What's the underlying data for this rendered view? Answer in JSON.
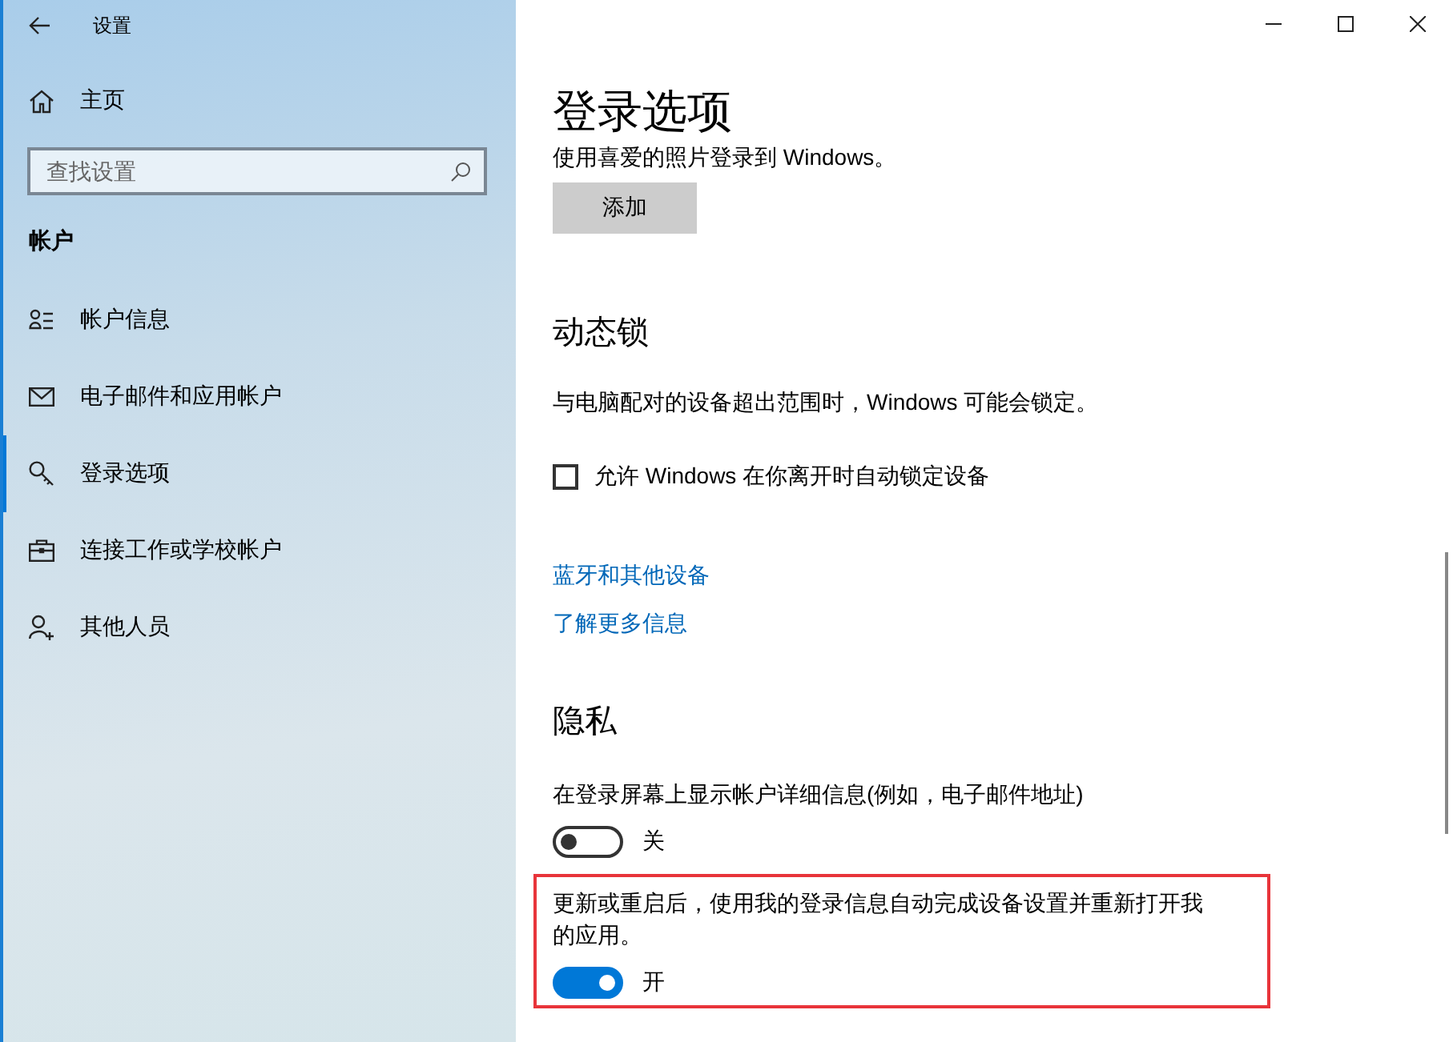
{
  "window": {
    "title": "设置"
  },
  "sidebar": {
    "home": "主页",
    "search": {
      "placeholder": "查找设置"
    },
    "section_title": "帐户",
    "items": [
      {
        "label": "帐户信息",
        "kind": "person-list",
        "selected": false
      },
      {
        "label": "电子邮件和应用帐户",
        "kind": "mail",
        "selected": false
      },
      {
        "label": "登录选项",
        "kind": "key",
        "selected": true
      },
      {
        "label": "连接工作或学校帐户",
        "kind": "briefcase",
        "selected": false
      },
      {
        "label": "其他人员",
        "kind": "person-add",
        "selected": false
      }
    ]
  },
  "page": {
    "title": "登录选项",
    "photo_text": "使用喜爱的照片登录到 Windows。",
    "add_button": "添加",
    "dynamic_lock": {
      "heading": "动态锁",
      "description": "与电脑配对的设备超出范围时，Windows 可能会锁定。",
      "checkbox": {
        "label": "允许 Windows 在你离开时自动锁定设备",
        "checked": false
      }
    },
    "links": [
      "蓝牙和其他设备",
      "了解更多信息"
    ],
    "privacy": {
      "heading": "隐私",
      "toggles": [
        {
          "label": "在登录屏幕上显示帐户详细信息(例如，电子邮件地址)",
          "on": false,
          "state_text": "关",
          "highlighted": false
        },
        {
          "label": "更新或重启后，使用我的登录信息自动完成设备设置并重新打开我的应用。",
          "on": true,
          "state_text": "开",
          "highlighted": true
        }
      ]
    }
  }
}
